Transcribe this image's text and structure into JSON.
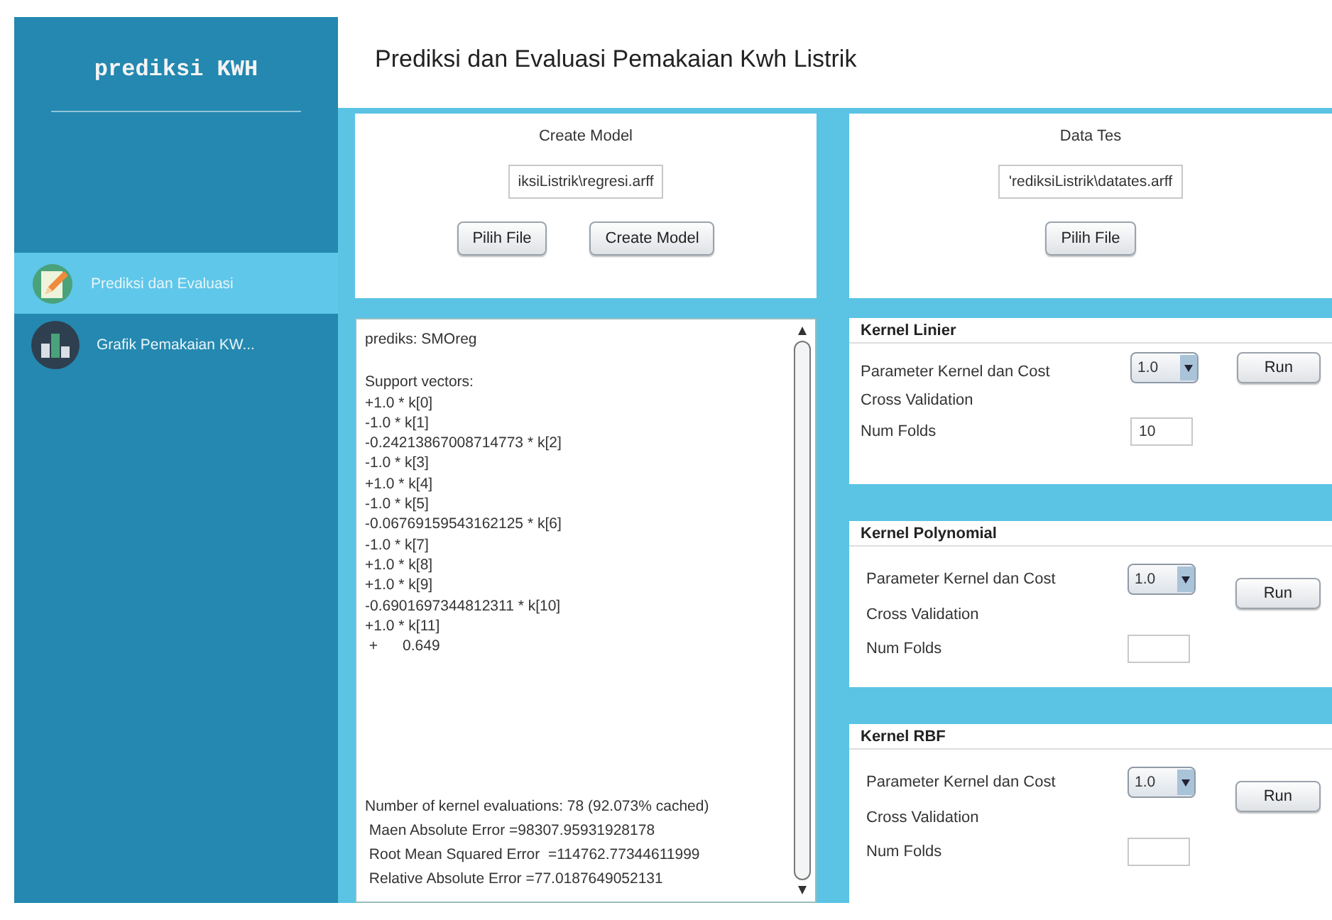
{
  "sidebar": {
    "title": "prediksi KWH",
    "items": [
      {
        "label": "Prediksi dan Evaluasi",
        "kind": "edit",
        "selected": true
      },
      {
        "label": "Grafik Pemakaian KW...",
        "kind": "chart",
        "selected": false
      }
    ]
  },
  "header": {
    "title": "Prediksi dan Evaluasi Pemakaian Kwh Listrik"
  },
  "cards": [
    {
      "title": "Create Model",
      "path": "iksiListrik\\regresi.arff",
      "buttons": [
        "Pilih File",
        "Create Model"
      ]
    },
    {
      "title": "Data Tes",
      "path": "'rediksiListrik\\datates.arff",
      "buttons": [
        "Pilih File"
      ]
    }
  ],
  "output": {
    "blocks": [
      [
        "prediks: SMOreg"
      ],
      [
        "Support vectors:",
        "+1.0 * k[0]",
        "-1.0 * k[1]",
        "-0.24213867008714773 * k[2]",
        "-1.0 * k[3]",
        "+1.0 * k[4]",
        "-1.0 * k[5]",
        "-0.06769159543162125 * k[6]",
        "-1.0 * k[7]",
        "+1.0 * k[8]",
        "+1.0 * k[9]",
        "-0.6901697344812311 * k[10]",
        "+1.0 * k[11]",
        " +      0.649"
      ],
      [
        "Number of kernel evaluations: 78 (92.073% cached)",
        " Maen Absolute Error =98307.95931928178",
        " Root Mean Squared Error  =114762.77344611999",
        " Relative Absolute Error =77.0187649052131"
      ]
    ]
  },
  "kernels": [
    {
      "title": "Kernel Linier",
      "kind": "inline-run",
      "param_label": "Parameter Kernel dan Cost",
      "param_value": "1.0",
      "run": "Run",
      "cv_label": "Cross Validation",
      "folds_label": "Num Folds",
      "folds_value": "10"
    },
    {
      "title": "Kernel Polynomial",
      "kind": "side-run",
      "param_label": "Parameter Kernel dan Cost",
      "param_value": "1.0",
      "run": "Run",
      "cv_label": "Cross Validation",
      "folds_label": "Num Folds"
    },
    {
      "title": "Kernel RBF",
      "kind": "side-run",
      "param_label": "Parameter Kernel dan Cost",
      "param_value": "1.0",
      "run": "Run",
      "cv_label": "Cross Validation",
      "folds_label": "Num Folds"
    }
  ]
}
